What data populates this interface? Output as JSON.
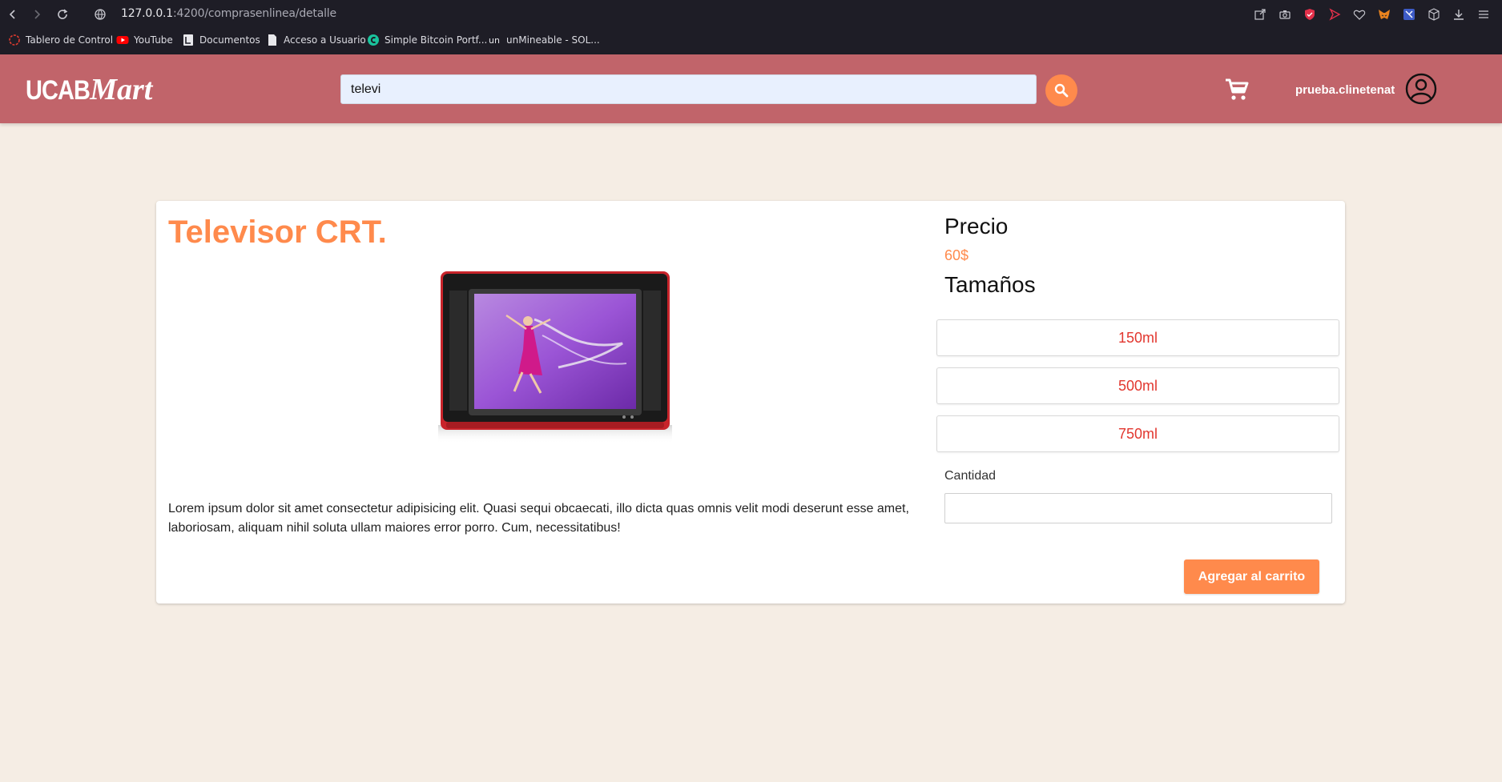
{
  "browser": {
    "url_host": "127.0.0.1",
    "url_rest": ":4200/comprasenlinea/detalle",
    "bookmarks": [
      {
        "label": "Tablero de Control",
        "icon": "dashboard-icon"
      },
      {
        "label": "YouTube",
        "icon": "youtube-icon"
      },
      {
        "label": "Documentos",
        "icon": "document-icon"
      },
      {
        "label": "Acceso a Usuario",
        "icon": "page-icon"
      },
      {
        "label": "Simple Bitcoin Portf...",
        "icon": "bitcoin-icon"
      },
      {
        "label": "unMineable - SOL...",
        "icon": "unmineable-icon"
      }
    ]
  },
  "header": {
    "logo_main": "UCAB",
    "logo_script": "Mart",
    "search_value": "televi",
    "username": "prueba.clinetenat",
    "bg_color": "#c1646a",
    "accent_color": "#ff8a4c"
  },
  "product": {
    "title": "Televisor CRT.",
    "description": "Lorem ipsum dolor sit amet consectetur adipisicing elit. Quasi sequi obcaecati, illo dicta quas omnis velit modi deserunt esse amet, laboriosam, aliquam nihil soluta ullam maiores error porro. Cum, necessitatibus!",
    "price_label": "Precio",
    "price_value": "60$",
    "sizes_label": "Tamaños",
    "sizes": [
      "150ml",
      "500ml",
      "750ml"
    ],
    "quantity_label": "Cantidad",
    "quantity_value": "",
    "add_to_cart_label": "Agregar al carrito"
  }
}
